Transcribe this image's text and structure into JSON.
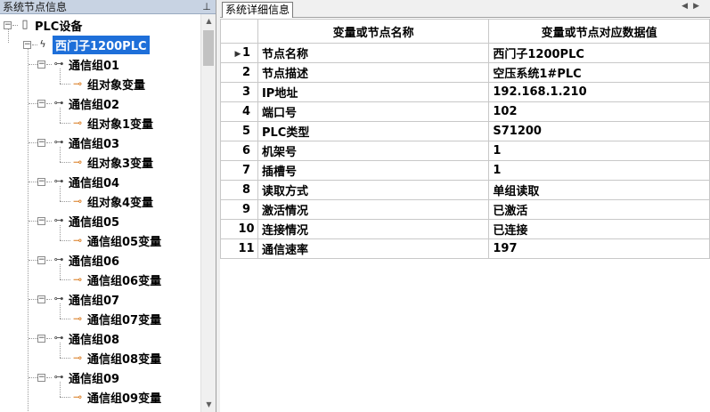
{
  "left_panel": {
    "title": "系统节点信息",
    "pin_glyph": "⊥"
  },
  "tree": {
    "root_label": "PLC设备",
    "device_label": "西门子1200PLC",
    "groups": [
      {
        "label": "通信组01",
        "child": "组对象变量"
      },
      {
        "label": "通信组02",
        "child": "组对象1变量"
      },
      {
        "label": "通信组03",
        "child": "组对象3变量"
      },
      {
        "label": "通信组04",
        "child": "组对象4变量"
      },
      {
        "label": "通信组05",
        "child": "通信组05变量"
      },
      {
        "label": "通信组06",
        "child": "通信组06变量"
      },
      {
        "label": "通信组07",
        "child": "通信组07变量"
      },
      {
        "label": "通信组08",
        "child": "通信组08变量"
      },
      {
        "label": "通信组09",
        "child": "通信组09变量"
      }
    ]
  },
  "right_panel": {
    "tab_label": "系统详细信息",
    "nav_left": "◀",
    "nav_right": "▶"
  },
  "table": {
    "headers": [
      "变量或节点名称",
      "变量或节点对应数据值"
    ],
    "current_row_marker": "▶",
    "rows": [
      {
        "index": "1",
        "name": "节点名称",
        "value": "西门子1200PLC"
      },
      {
        "index": "2",
        "name": "节点描述",
        "value": "空压系统1#PLC"
      },
      {
        "index": "3",
        "name": "IP地址",
        "value": "192.168.1.210"
      },
      {
        "index": "4",
        "name": "端口号",
        "value": "102"
      },
      {
        "index": "5",
        "name": "PLC类型",
        "value": "S71200"
      },
      {
        "index": "6",
        "name": "机架号",
        "value": "1"
      },
      {
        "index": "7",
        "name": "插槽号",
        "value": "1"
      },
      {
        "index": "8",
        "name": "读取方式",
        "value": "单组读取"
      },
      {
        "index": "9",
        "name": "激活情况",
        "value": "已激活"
      },
      {
        "index": "10",
        "name": "连接情况",
        "value": "已连接"
      },
      {
        "index": "11",
        "name": "通信速率",
        "value": "197"
      }
    ]
  }
}
